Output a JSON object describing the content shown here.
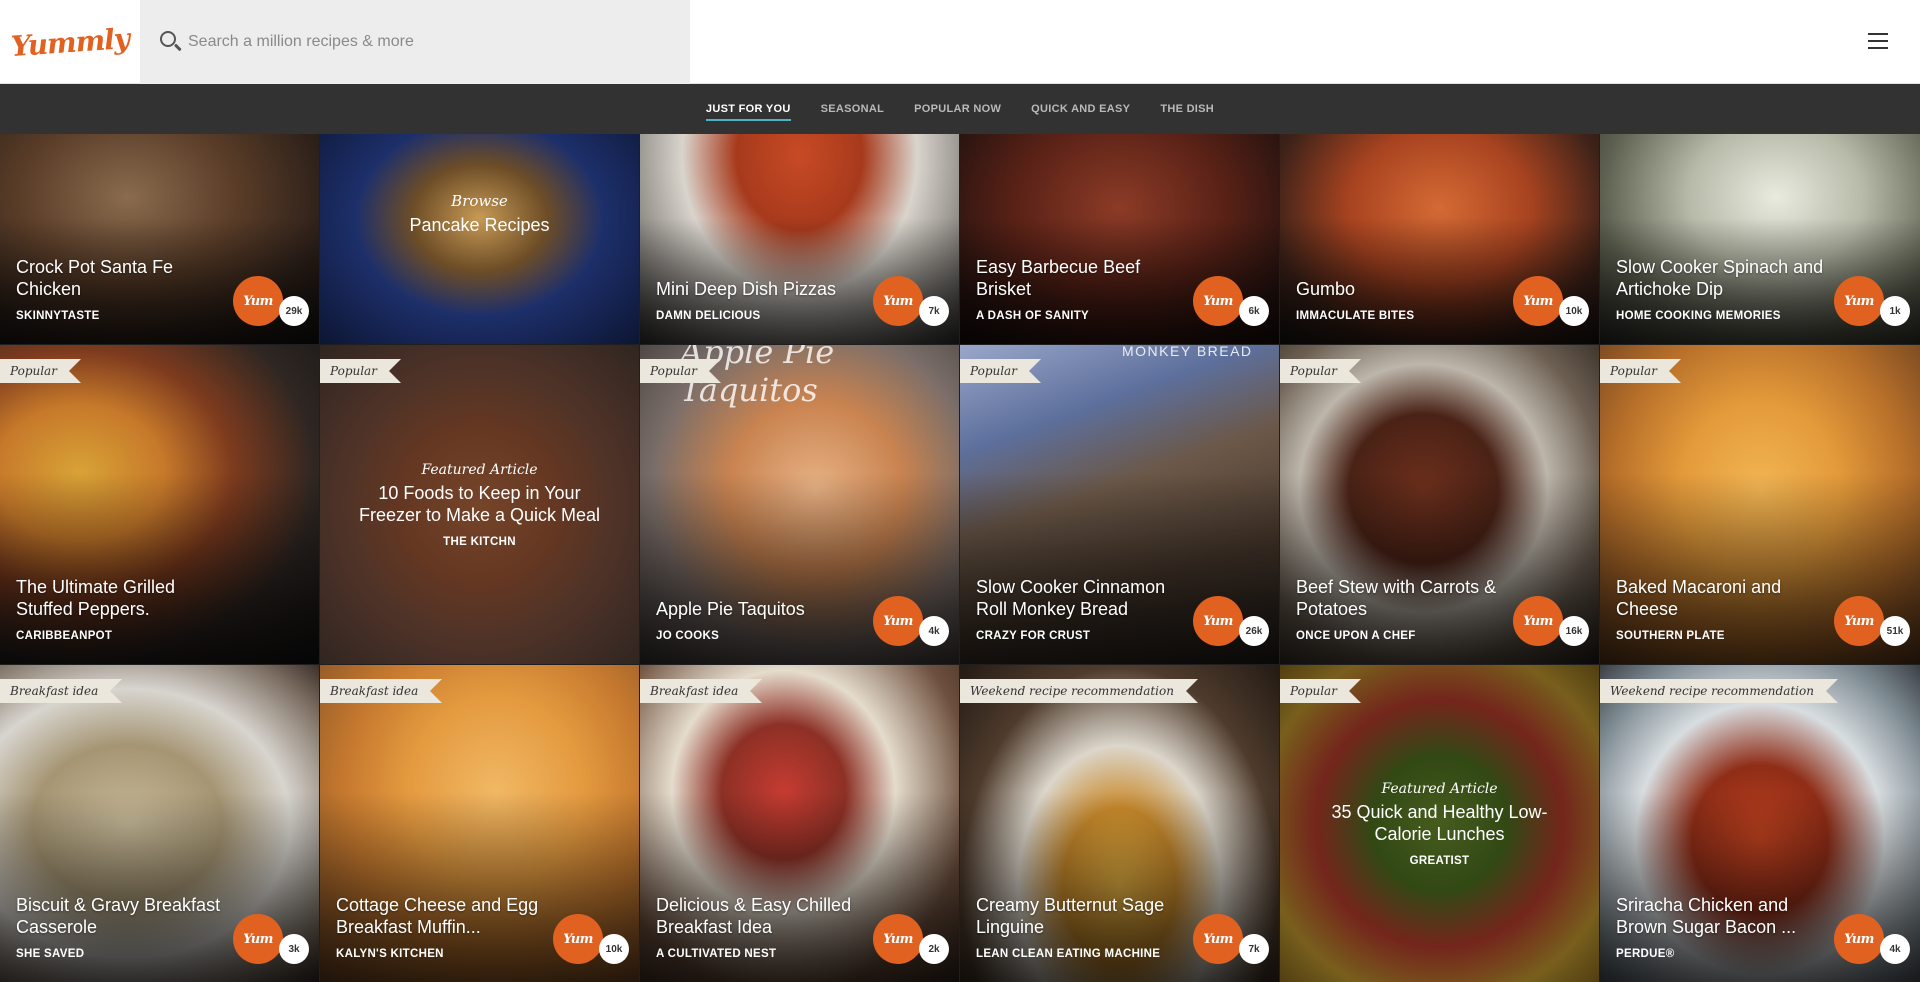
{
  "header": {
    "logo": "Yummly",
    "search_placeholder": "Search a million recipes & more"
  },
  "subnav": [
    "JUST FOR YOU",
    "SEASONAL",
    "POPULAR NOW",
    "QUICK AND EASY",
    "THE DISH"
  ],
  "row1": [
    {
      "type": "recipe",
      "title": "Crock Pot Santa Fe Chicken",
      "source": "SKINNYTASTE",
      "yums": "29k"
    },
    {
      "type": "browse",
      "kicker": "Browse",
      "title": "Pancake Recipes"
    },
    {
      "type": "recipe",
      "title": "Mini Deep Dish Pizzas",
      "source": "DAMN DELICIOUS",
      "yums": "7k"
    },
    {
      "type": "recipe",
      "title": "Easy Barbecue Beef Brisket",
      "source": "A DASH OF SANITY",
      "yums": "6k"
    },
    {
      "type": "recipe",
      "title": "Gumbo",
      "source": "IMMACULATE BITES",
      "yums": "10k"
    },
    {
      "type": "recipe",
      "title": "Slow Cooker Spinach and Artichoke Dip",
      "source": "HOME COOKING MEMORIES",
      "yums": "1k"
    }
  ],
  "row2": [
    {
      "type": "recipe",
      "tag": "Popular",
      "title": "The Ultimate Grilled Stuffed Peppers.",
      "source": "CARIBBEANPOT",
      "yums": ""
    },
    {
      "type": "article",
      "tag": "Popular",
      "kicker": "Featured Article",
      "title": "10 Foods to Keep in Your Freezer to Make a Quick Meal",
      "source": "THE KITCHN"
    },
    {
      "type": "recipe",
      "tag": "Popular",
      "title": "Apple Pie Taquitos",
      "source": "JO COOKS",
      "yums": "4k",
      "overlay": "Apple Pie Taquitos"
    },
    {
      "type": "recipe",
      "tag": "Popular",
      "title": "Slow Cooker Cinnamon Roll Monkey Bread",
      "source": "CRAZY FOR CRUST",
      "yums": "26k",
      "overlay": "MONKEY BREAD"
    },
    {
      "type": "recipe",
      "tag": "Popular",
      "title": "Beef Stew with Carrots & Potatoes",
      "source": "ONCE UPON A CHEF",
      "yums": "16k"
    },
    {
      "type": "recipe",
      "tag": "Popular",
      "title": "Baked Macaroni and Cheese",
      "source": "SOUTHERN PLATE",
      "yums": "51k"
    }
  ],
  "row3": [
    {
      "type": "recipe",
      "tag": "Breakfast idea",
      "title": "Biscuit & Gravy Breakfast Casserole",
      "source": "SHE SAVED",
      "yums": "3k"
    },
    {
      "type": "recipe",
      "tag": "Breakfast idea",
      "title": "Cottage Cheese and Egg Breakfast Muffin...",
      "source": "KALYN'S KITCHEN",
      "yums": "10k"
    },
    {
      "type": "recipe",
      "tag": "Breakfast idea",
      "title": "Delicious & Easy Chilled Breakfast Idea",
      "source": "A CULTIVATED NEST",
      "yums": "2k"
    },
    {
      "type": "recipe",
      "tag": "Weekend recipe recommendation",
      "title": "Creamy Butternut Sage Linguine",
      "source": "LEAN CLEAN EATING MACHINE",
      "yums": "7k"
    },
    {
      "type": "article",
      "tag": "Popular",
      "kicker": "Featured Article",
      "title": "35 Quick and Healthy Low-Calorie Lunches",
      "source": "GREATIST"
    },
    {
      "type": "recipe",
      "tag": "Weekend recipe recommendation",
      "title": "Sriracha Chicken and Brown Sugar Bacon ...",
      "source": "PERDUE®",
      "yums": "4k"
    }
  ],
  "yum_label": "Yum",
  "colors": {
    "accent": "#e16120",
    "nav_underline": "#4bb3c6",
    "nav_bg": "#323232"
  }
}
